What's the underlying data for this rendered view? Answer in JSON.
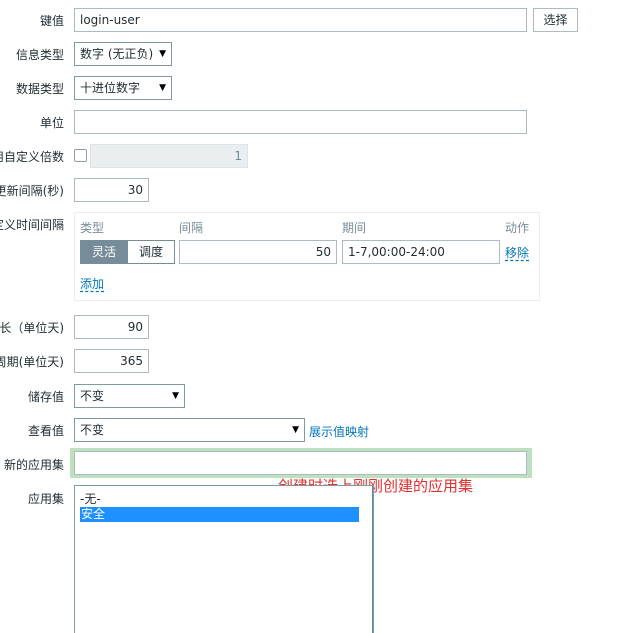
{
  "key": {
    "label": "键值",
    "value": "login-user",
    "button": "选择"
  },
  "info_type": {
    "label": "信息类型",
    "selected": "数字 (无正负)"
  },
  "data_type": {
    "label": "数据类型",
    "selected": "十进位数字"
  },
  "units": {
    "label": "单位",
    "value": ""
  },
  "custom_multiplier": {
    "label": "用自定义倍数",
    "value": "1"
  },
  "update_interval": {
    "label": "更新间隔(秒)",
    "value": "30"
  },
  "custom_intervals": {
    "label": "自定义时间间隔",
    "headers": {
      "type": "类型",
      "interval": "间隔",
      "period": "期间",
      "action": "动作"
    },
    "type_options": [
      "灵活",
      "调度"
    ],
    "interval_value": "50",
    "period_value": "1-7,00:00-24:00",
    "remove": "移除",
    "add": "添加"
  },
  "history": {
    "label": "长（单位天)",
    "value": "90"
  },
  "trends": {
    "label": "周期(单位天)",
    "value": "365"
  },
  "store_value": {
    "label": "储存值",
    "selected": "不变"
  },
  "show_value": {
    "label": "查看值",
    "selected": "不变",
    "link": "展示值映射"
  },
  "new_application": {
    "label": "新的应用集",
    "value": ""
  },
  "applications": {
    "label": "应用集",
    "options": [
      "-无-",
      "安全"
    ],
    "selected_index": 1
  },
  "annotation": "创建时选上刚刚创建的应用集",
  "colors": {
    "annotation": "#e03030",
    "highlight": "#bfe0bf",
    "selected": "#1e90ff",
    "link": "#0275b8"
  }
}
